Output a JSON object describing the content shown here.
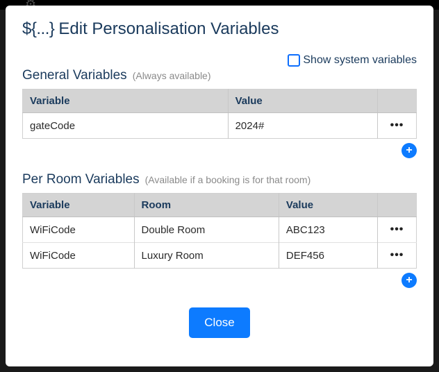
{
  "modal": {
    "title_prefix": "${...}",
    "title_text": "Edit Personalisation Variables",
    "show_system_label": "Show system variables",
    "close_label": "Close"
  },
  "general": {
    "heading": "General Variables",
    "hint": "(Always available)",
    "columns": {
      "variable": "Variable",
      "value": "Value"
    },
    "rows": [
      {
        "variable": "gateCode",
        "value": "2024#"
      }
    ]
  },
  "per_room": {
    "heading": "Per Room Variables",
    "hint": "(Available if a booking is for that room)",
    "columns": {
      "variable": "Variable",
      "room": "Room",
      "value": "Value"
    },
    "rows": [
      {
        "variable": "WiFiCode",
        "room": "Double Room",
        "value": "ABC123"
      },
      {
        "variable": "WiFiCode",
        "room": "Luxury Room",
        "value": "DEF456"
      }
    ]
  },
  "icons": {
    "ellipsis": "•••",
    "plus": "+"
  }
}
